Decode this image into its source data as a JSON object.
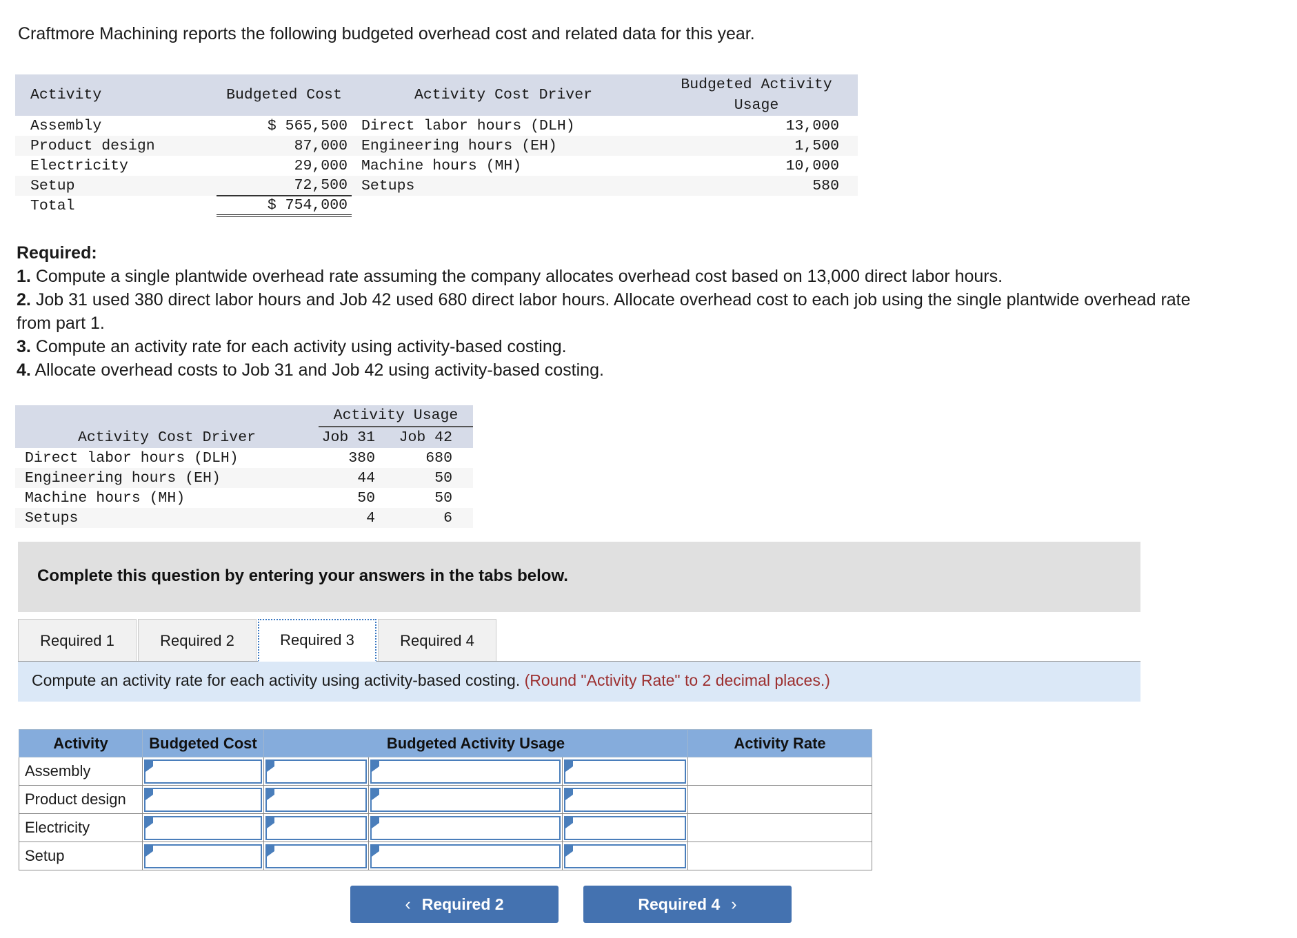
{
  "intro": "Craftmore Machining reports the following budgeted overhead cost and related data for this year.",
  "overhead_table": {
    "headers": [
      "Activity",
      "Budgeted Cost",
      "Activity Cost Driver",
      "Budgeted Activity Usage"
    ],
    "rows": [
      {
        "activity": "Assembly",
        "cost": "$ 565,500",
        "driver": "Direct labor hours (DLH)",
        "usage": "13,000"
      },
      {
        "activity": "Product design",
        "cost": "87,000",
        "driver": "Engineering hours (EH)",
        "usage": "1,500"
      },
      {
        "activity": "Electricity",
        "cost": "29,000",
        "driver": "Machine hours (MH)",
        "usage": "10,000"
      },
      {
        "activity": "Setup",
        "cost": "72,500",
        "driver": "Setups",
        "usage": "580"
      }
    ],
    "total": {
      "activity": "Total",
      "cost": "$ 754,000",
      "driver": "",
      "usage": ""
    }
  },
  "required": {
    "title": "Required:",
    "items": [
      {
        "num": "1.",
        "text": "Compute a single plantwide overhead rate assuming the company allocates overhead cost based on 13,000 direct labor hours."
      },
      {
        "num": "2.",
        "text": "Job 31 used 380 direct labor hours and Job 42 used 680 direct labor hours. Allocate overhead cost to each job using the single plantwide overhead rate from part 1."
      },
      {
        "num": "3.",
        "text": "Compute an activity rate for each activity using activity-based costing."
      },
      {
        "num": "4.",
        "text": "Allocate overhead costs to Job 31 and Job 42 using activity-based costing."
      }
    ]
  },
  "usage_table": {
    "group_header": "Activity Usage",
    "headers": [
      "Activity Cost Driver",
      "Job 31",
      "Job 42"
    ],
    "rows": [
      {
        "driver": "Direct labor hours (DLH)",
        "job31": "380",
        "job42": "680"
      },
      {
        "driver": "Engineering hours (EH)",
        "job31": "44",
        "job42": "50"
      },
      {
        "driver": "Machine hours (MH)",
        "job31": "50",
        "job42": "50"
      },
      {
        "driver": "Setups",
        "job31": "4",
        "job42": "6"
      }
    ]
  },
  "banner": {
    "text": "Complete this question by entering your answers in the tabs below."
  },
  "tabs": [
    {
      "label": "Required 1",
      "active": false
    },
    {
      "label": "Required 2",
      "active": false
    },
    {
      "label": "Required 3",
      "active": true
    },
    {
      "label": "Required 4",
      "active": false
    }
  ],
  "instruction": {
    "main": "Compute an activity rate for each activity using activity-based costing.",
    "note": "(Round \"Activity Rate\" to 2 decimal places.)"
  },
  "answer_grid": {
    "headers": [
      "Activity",
      "Budgeted Cost",
      "Budgeted Activity Usage",
      "Activity Rate"
    ],
    "rows": [
      {
        "activity": "Assembly",
        "cost": "",
        "usage1": "",
        "usage2": "",
        "usage3": "",
        "rate": ""
      },
      {
        "activity": "Product design",
        "cost": "",
        "usage1": "",
        "usage2": "",
        "usage3": "",
        "rate": ""
      },
      {
        "activity": "Electricity",
        "cost": "",
        "usage1": "",
        "usage2": "",
        "usage3": "",
        "rate": ""
      },
      {
        "activity": "Setup",
        "cost": "",
        "usage1": "",
        "usage2": "",
        "usage3": "",
        "rate": ""
      }
    ]
  },
  "nav": {
    "prev_label": "Required 2",
    "prev_chevron": "‹",
    "next_label": "Required 4",
    "next_chevron": "›"
  },
  "colors": {
    "header_blue": "#85ACDC",
    "mono_header": "#d6dbe8",
    "grey_banner": "#e0e0e0",
    "instruction_blue": "#dbe8f7",
    "note_red": "#9c2f2f",
    "button_blue": "#4472b0",
    "input_border": "#4a7ebb"
  }
}
